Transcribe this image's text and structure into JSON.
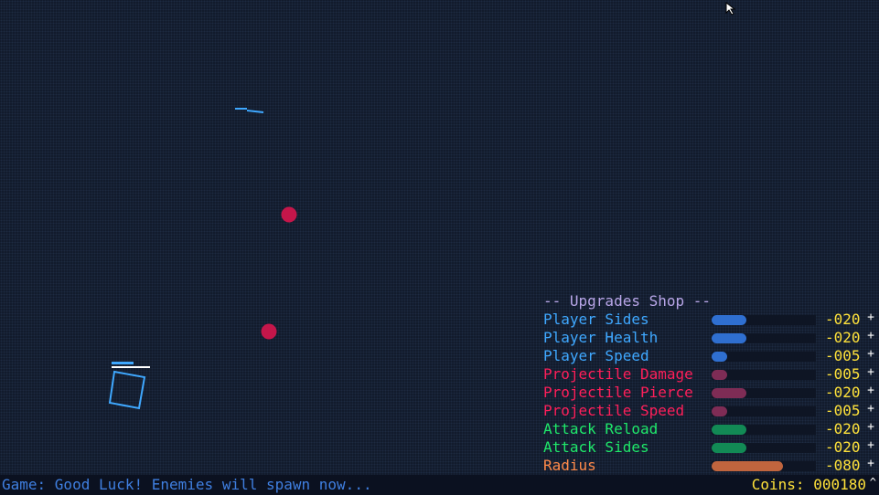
{
  "shop": {
    "title": "-- Upgrades Shop --",
    "items": [
      {
        "label": "Player Sides",
        "cost": "-020",
        "plus": "+",
        "level": 0.33,
        "label_color": "#3fa8ff",
        "bar_color": "#2f6fd0"
      },
      {
        "label": "Player Health",
        "cost": "-020",
        "plus": "+",
        "level": 0.33,
        "label_color": "#3fa8ff",
        "bar_color": "#2f6fd0"
      },
      {
        "label": "Player Speed",
        "cost": "-005",
        "plus": "+",
        "level": 0.15,
        "label_color": "#3fa8ff",
        "bar_color": "#2f6fd0"
      },
      {
        "label": "Projectile Damage",
        "cost": "-005",
        "plus": "+",
        "level": 0.15,
        "label_color": "#ff1f5a",
        "bar_color": "#7e2c55"
      },
      {
        "label": "Projectile Pierce",
        "cost": "-020",
        "plus": "+",
        "level": 0.33,
        "label_color": "#ff1f5a",
        "bar_color": "#7e2c55"
      },
      {
        "label": "Projectile Speed",
        "cost": "-005",
        "plus": "+",
        "level": 0.15,
        "label_color": "#ff1f5a",
        "bar_color": "#7e2c55"
      },
      {
        "label": "Attack Reload",
        "cost": "-020",
        "plus": "+",
        "level": 0.33,
        "label_color": "#1fe86a",
        "bar_color": "#128a55"
      },
      {
        "label": "Attack Sides",
        "cost": "-020",
        "plus": "+",
        "level": 0.33,
        "label_color": "#1fe86a",
        "bar_color": "#128a55"
      },
      {
        "label": "Radius",
        "cost": "-080",
        "plus": "+",
        "level": 0.68,
        "label_color": "#ff8a4a",
        "bar_color": "#c0653e"
      }
    ]
  },
  "status": {
    "message": "Game: Good Luck! Enemies will spawn now...",
    "coins": "Coins: 000180",
    "coins_caret": "^"
  },
  "colors": {
    "background": "#111a2b",
    "enemy": "#c4164a",
    "player": "#3fa8ff",
    "player_health": "#ffffff",
    "coin_text": "#ffe23a"
  },
  "player": {
    "health": 1.0,
    "sides": 4
  }
}
